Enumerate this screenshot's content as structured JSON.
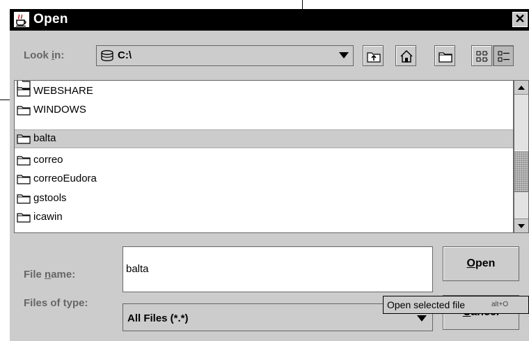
{
  "window": {
    "title": "Open",
    "close_glyph": "✕"
  },
  "look_in": {
    "label_pre": "Look ",
    "label_mnemonic": "i",
    "label_post": "n:",
    "value": "C:\\"
  },
  "toolbar": {
    "buttons": [
      "up-one-level",
      "home",
      "new-folder",
      "list-view",
      "details-view"
    ],
    "active": "details-view"
  },
  "file_list": {
    "items": [
      {
        "name": "WEBSHARE",
        "selected": false
      },
      {
        "name": "WINDOWS",
        "selected": false
      },
      {
        "name": "balta",
        "selected": true
      },
      {
        "name": "correo",
        "selected": false
      },
      {
        "name": "correoEudora",
        "selected": false
      },
      {
        "name": "gstools",
        "selected": false
      },
      {
        "name": "icawin",
        "selected": false
      }
    ]
  },
  "file_name": {
    "label_pre": "File ",
    "label_mnemonic": "n",
    "label_post": "ame:",
    "value": "balta"
  },
  "files_of_type": {
    "label": "Files of type:",
    "value": "All Files (*.*)"
  },
  "buttons": {
    "open_mnemonic": "O",
    "open_rest": "pen",
    "cancel_mnemonic": "C",
    "cancel_rest": "ancel"
  },
  "tooltip": {
    "text": "Open selected file",
    "shortcut": "alt+O"
  },
  "colors": {
    "dialog_bg": "#cccccc",
    "title_bar": "#000000",
    "label_text": "#666666",
    "selection": "#cccccc"
  }
}
